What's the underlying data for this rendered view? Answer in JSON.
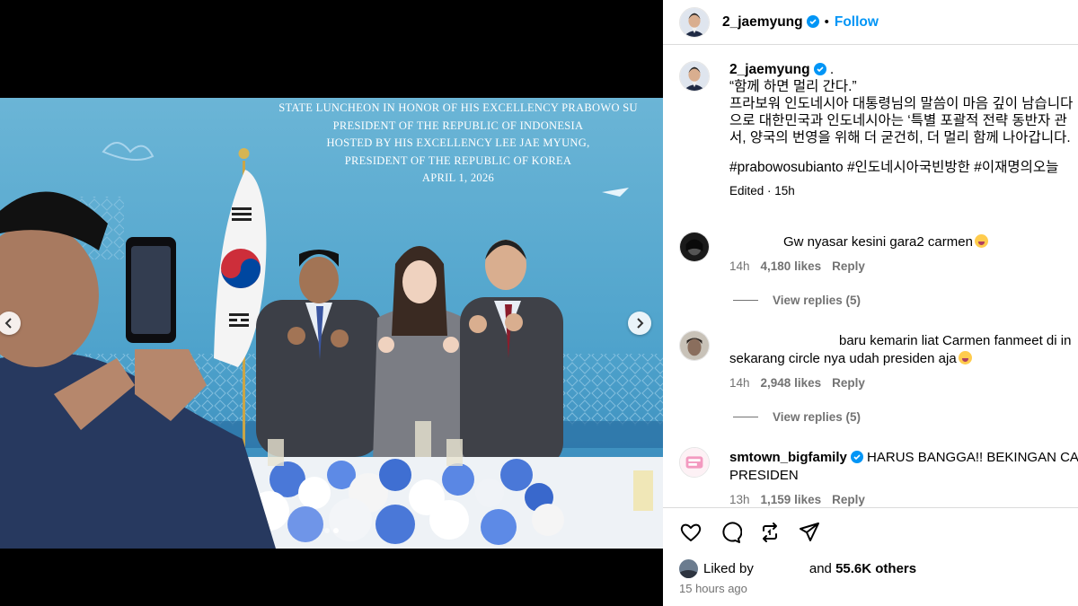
{
  "banner": {
    "lines": [
      "STATE LUNCHEON IN HONOR OF HIS EXCELLENCY PRABOWO SU",
      "PRESIDENT OF THE REPUBLIC OF INDONESIA",
      "HOSTED BY HIS EXCELLENCY LEE JAE MYUNG,",
      "PRESIDENT OF THE REPUBLIC OF KOREA",
      "APRIL 1, 2026"
    ]
  },
  "carousel": {
    "active_index": 1,
    "total": 2
  },
  "header": {
    "username": "2_jaemyung",
    "separator": "•",
    "follow_label": "Follow"
  },
  "caption": {
    "username": "2_jaemyung",
    "after_name": " .",
    "lines": [
      "“함께 하면 멀리 간다.”",
      "프라보워 인도네시아 대통령님의 말씀이 마음 깊이 남습니다",
      "으로 대한민국과 인도네시아는 ‘특별 포괄적 전략 동반자 관",
      "서, 양국의 번영을 위해 더 굳건히, 더 멀리 함께 나아갑니다."
    ],
    "hashtags": "#prabowosubianto #인도네시아국빈방한 #이재명의오늘",
    "meta": "Edited · 15h"
  },
  "comments": [
    {
      "username": "",
      "text": "Gw nyasar kesini gara2 carmen",
      "time": "14h",
      "likes": "4,180 likes",
      "reply": "Reply",
      "view_replies": "View replies (5)"
    },
    {
      "username": "",
      "text_lines": [
        "baru kemarin liat Carmen fanmeet di in",
        "sekarang circle nya udah presiden aja"
      ],
      "time": "14h",
      "likes": "2,948 likes",
      "reply": "Reply",
      "view_replies": "View replies (5)"
    },
    {
      "username": "smtown_bigfamily",
      "text_lines": [
        "HARUS BANGGA!! BEKINGAN CARM",
        "PRESIDEN"
      ],
      "time": "13h",
      "likes": "1,159 likes",
      "reply": "Reply"
    }
  ],
  "likes": {
    "prefix": "Liked by",
    "suffix": "and",
    "count": "55.6K others"
  },
  "time_ago": "15 hours ago",
  "colors": {
    "accent": "#0095f6",
    "hashtag": "#00376b",
    "muted": "#737373",
    "border": "#dbdbdb"
  },
  "icons": [
    "heart-icon",
    "comment-icon",
    "repost-icon",
    "share-icon",
    "verified-badge-icon",
    "chevron-left-icon",
    "chevron-right-icon"
  ]
}
